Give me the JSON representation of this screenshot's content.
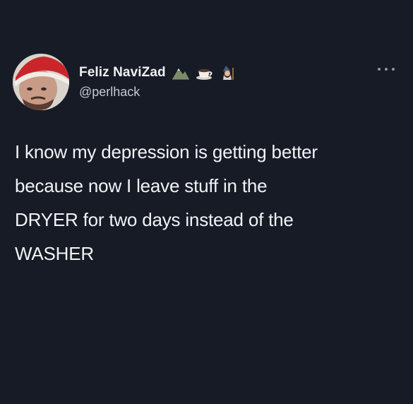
{
  "tweet": {
    "author": {
      "display_name": "Feliz NaviZad",
      "handle": "@perlhack",
      "avatar_icon": "avatar-santa-hat",
      "name_emojis": [
        "mountain-icon",
        "coffee-cup-icon",
        "wizard-icon"
      ]
    },
    "more_icon": "more-options-icon",
    "text_lines": [
      "I know my depression is getting better",
      "because now I leave stuff in the",
      "DRYER for two days instead of the",
      "WASHER"
    ]
  },
  "colors": {
    "background": "#161b26",
    "text": "#f1f3f6",
    "secondary_text": "#c6cad2"
  }
}
